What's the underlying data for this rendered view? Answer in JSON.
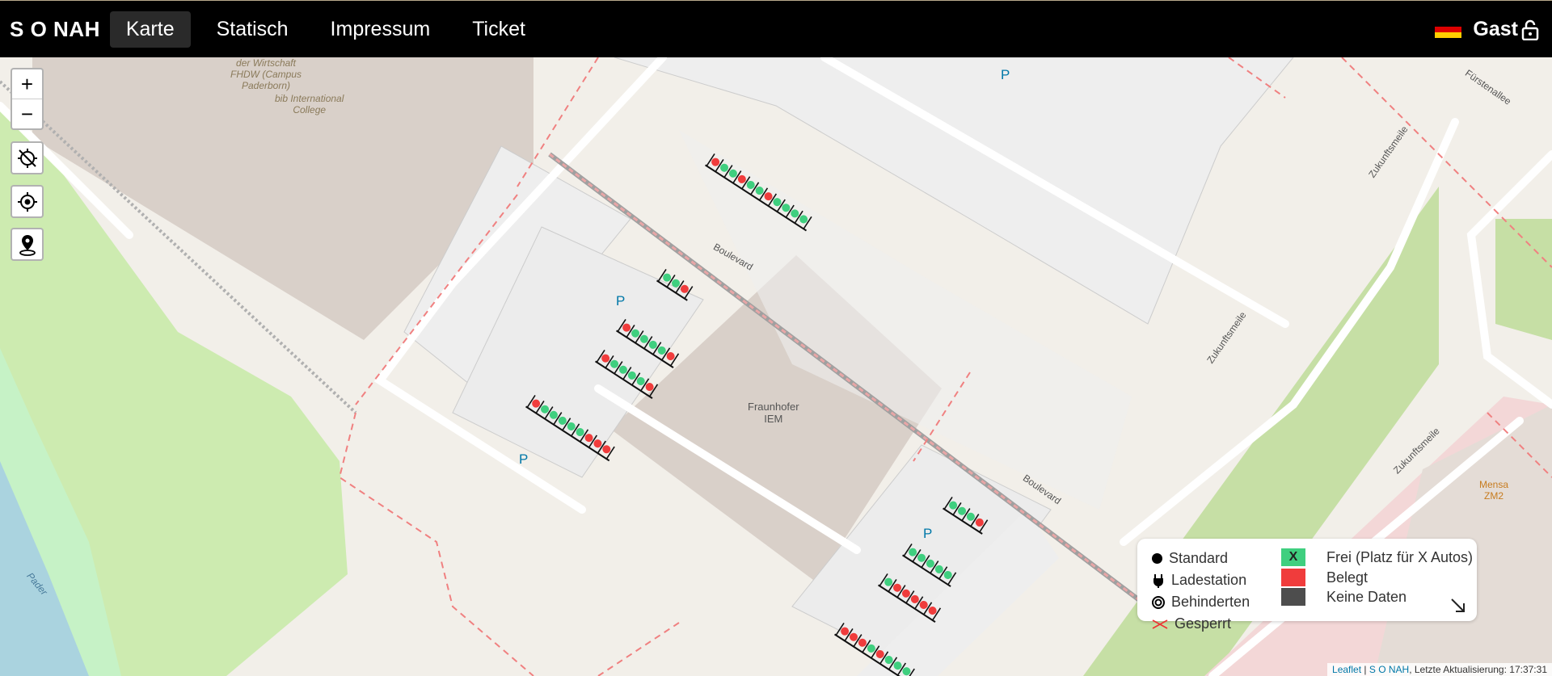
{
  "nav": {
    "brand": "S O NAH",
    "items": [
      {
        "label": "Karte",
        "active": true
      },
      {
        "label": "Statisch",
        "active": false
      },
      {
        "label": "Impressum",
        "active": false
      },
      {
        "label": "Ticket",
        "active": false
      }
    ],
    "user": "Gast"
  },
  "map": {
    "zoom_in": "+",
    "zoom_out": "−",
    "labels": {
      "fhdw": "der Wirtschaft\nFHDW (Campus\nPaderborn)",
      "bib": "bib International\nCollege",
      "fraunhofer": "Fraunhofer\nIEM",
      "boulevard1": "Boulevard",
      "boulevard2": "Boulevard",
      "zukunft1": "Zukunftsmeile",
      "zukunft2": "Zukunftsmeile",
      "zukunft3": "Zukunftsmeile",
      "fuersten": "Fürstenallee",
      "mensa": "Mensa\nZM2",
      "pader": "Pader",
      "p": "P"
    }
  },
  "legend": {
    "standard": "Standard",
    "ladestation": "Ladestation",
    "behinderten": "Behinderten",
    "gesperrt": "Gesperrt",
    "frei_mark": "X",
    "frei": "Frei (Platz für X Autos)",
    "belegt": "Belegt",
    "keine": "Keine Daten"
  },
  "attribution": {
    "leaflet": "Leaflet",
    "sep": " | ",
    "sonah": "S O NAH",
    "update": ", Letzte Aktualisierung: 17:37:31"
  },
  "colors": {
    "free": "#3fcf7f",
    "occupied": "#f03c3c",
    "nodata": "#4d4d4d",
    "accent": "#0078a8"
  }
}
